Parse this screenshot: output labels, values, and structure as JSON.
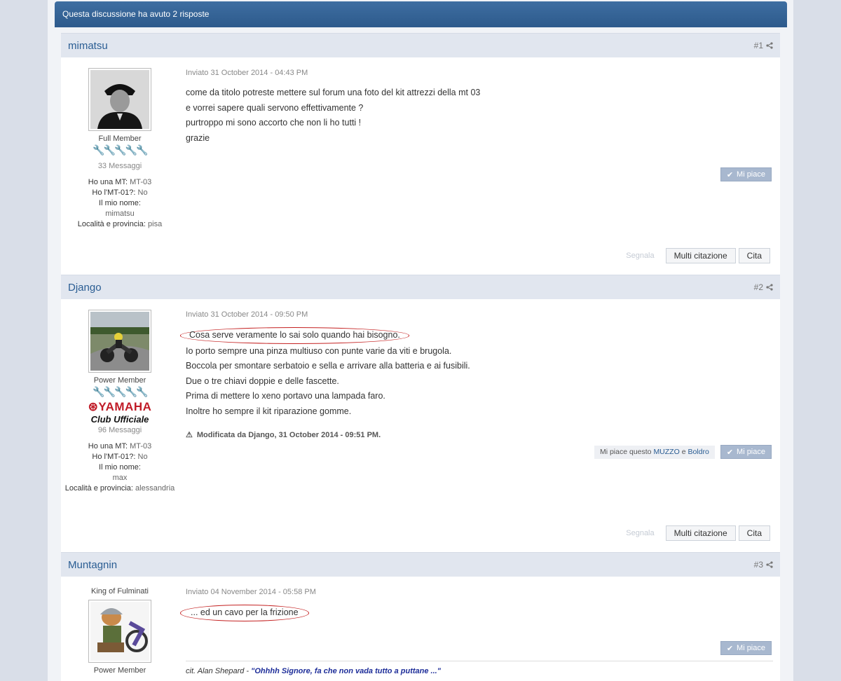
{
  "thread": {
    "replies_banner": "Questa discussione ha avuto 2 risposte"
  },
  "posts": [
    {
      "author": "mimatsu",
      "number": "#1",
      "rank": "Full Member",
      "wrenches_on": "🔧🔧",
      "wrenches_off": "🔧🔧🔧",
      "messages": "33 Messaggi",
      "info": [
        {
          "label": "Ho una MT:",
          "value": "MT-03"
        },
        {
          "label": "Ho l'MT-01?:",
          "value": "No"
        },
        {
          "label": "Il mio nome:",
          "value": "mimatsu"
        },
        {
          "label": "Località e provincia:",
          "value": "pisa"
        }
      ],
      "date": "Inviato 31 October 2014 - 04:43 PM",
      "lines": [
        "come da titolo potreste  mettere sul forum una foto del kit attrezzi della mt 03",
        "e vorrei sapere quali servono effettivamente ?",
        "purtroppo mi sono accorto che non li ho tutti !",
        "grazie"
      ],
      "like_label": "Mi piace",
      "report_label": "Segnala",
      "multiquote_label": "Multi citazione",
      "quote_label": "Cita"
    },
    {
      "author": "Django",
      "number": "#2",
      "rank": "Power Member",
      "wrenches_on": "🔧🔧",
      "wrenches_off": "🔧🔧🔧",
      "badge_brand": "⊛YAMAHA",
      "badge_club": "Club Ufficiale",
      "messages": "96 Messaggi",
      "info": [
        {
          "label": "Ho una MT:",
          "value": "MT-03"
        },
        {
          "label": "Ho l'MT-01?:",
          "value": "No"
        },
        {
          "label": "Il mio nome:",
          "value": "max"
        },
        {
          "label": "Località e provincia:",
          "value": "alessandria"
        }
      ],
      "date": "Inviato 31 October 2014 - 09:50 PM",
      "first_line": "Cosa serve veramente lo sai solo quando hai bisogno.",
      "lines": [
        "Io porto sempre una pinza multiuso con punte varie da viti e brugola.",
        "Boccola per smontare serbatoio e sella e arrivare alla batteria e ai fusibili.",
        "Due o tre chiavi doppie e delle fascette.",
        "Prima di mettere lo xeno portavo una lampada faro.",
        "Inoltre ho sempre il kit riparazione gomme."
      ],
      "edited": "Modificata da Django, 31 October 2014 - 09:51 PM.",
      "likes_prefix": "Mi piace questo",
      "likes_user1": "MUZZO",
      "likes_and": "e",
      "likes_user2": "Boldro",
      "like_label": "Mi piace",
      "report_label": "Segnala",
      "multiquote_label": "Multi citazione",
      "quote_label": "Cita"
    },
    {
      "author": "Muntagnin",
      "number": "#3",
      "title": "King of Fulminati",
      "rank": "Power Member",
      "date": "Inviato 04 November 2014 - 05:58 PM",
      "first_line": "... ed un cavo per la frizione",
      "like_label": "Mi piace",
      "sig_prefix": "cit. Alan Shepard - ",
      "sig_quote": "\"Ohhhh Signore, fa che non vada tutto a puttane ...\""
    }
  ],
  "colors": {
    "accent": "#2a5d93",
    "header_bar": "#2d5a8c",
    "circle": "#c42121"
  }
}
